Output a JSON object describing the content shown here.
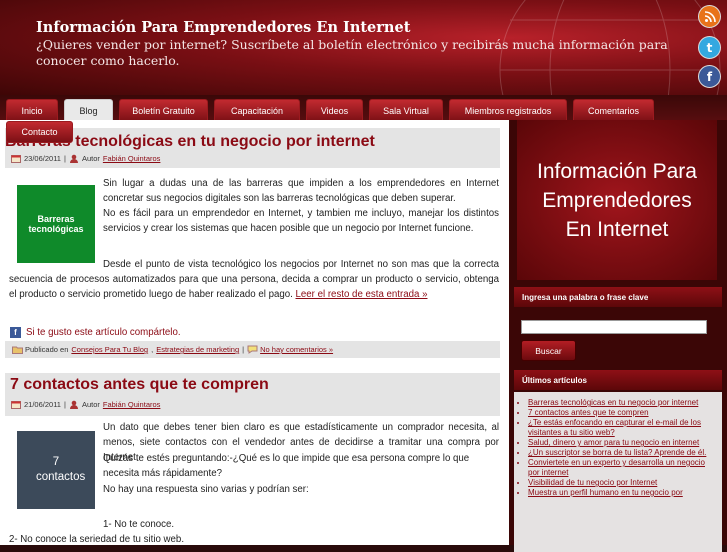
{
  "header": {
    "site_title": "Información Para Emprendedores En Internet",
    "tagline": "¿Quieres vender por internet? Suscríbete al boletín electrónico y recibirás mucha información para conocer como hacerlo."
  },
  "social": {
    "rss": "rss-icon",
    "twitter": "twitter-icon",
    "facebook": "facebook-icon"
  },
  "nav": {
    "tabs": [
      {
        "label": "Inicio"
      },
      {
        "label": "Blog"
      },
      {
        "label": "Boletín Gratuito"
      },
      {
        "label": "Capacitación"
      },
      {
        "label": "Videos"
      },
      {
        "label": "Sala Virtual"
      },
      {
        "label": "Miembros registrados"
      },
      {
        "label": "Comentarios"
      },
      {
        "label": "Contacto"
      }
    ]
  },
  "posts": [
    {
      "title": "Barreras tecnológicas en tu negocio por internet",
      "date": "23/06/2011",
      "author_prefix": "Autor",
      "author": "Fabián Quintaros",
      "thumb_text": "Barreras tecnológicas",
      "p1": "Sin lugar a dudas una de las barreras que impiden a los emprendedores en Internet concretar sus negocios digitales son las barreras tecnológicas que deben superar.",
      "p2": "No es fácil para un emprendedor en Internet, y tambien me incluyo, manejar los distintos servicios y crear los sistemas que hacen posible que un negocio por Internet funcione.",
      "p3": "Desde el punto de vista tecnológico los negocios por Internet no son mas que la correcta secuencia de procesos automatizados para que una persona, decida a comprar un producto o servicio, obtenga el producto o servicio prometido luego de haber realizado el pago.",
      "read_more": "Leer el resto de esta entrada »",
      "share_text": "Si te gusto este artículo compártelo.",
      "published_in": "Publicado en",
      "cat1": "Consejos Para Tu Blog",
      "cat2": "Estrategias de marketing",
      "comments": "No hay comentarios »"
    },
    {
      "title": "7 contactos antes que te compren",
      "date": "21/06/2011",
      "author_prefix": "Autor",
      "author": "Fabián Quintaros",
      "thumb_text": "7 contactos",
      "p1": "Un dato que debes tener bien claro es que estadísticamente un comprador necesita, al menos, siete contactos con el vendedor antes de decidirse a tramitar una compra por Internet.",
      "p2": "Quizás te estés preguntando:-¿Qué es lo que impide que esa persona compre lo que necesita más rápidamente?",
      "p3": "No hay una respuesta sino varias y podrían ser:",
      "p4": "1- No te conoce.",
      "p5": "2- No conoce la seriedad de tu sitio web."
    }
  ],
  "sidebar": {
    "promo_text": "Información Para Emprendedores En Internet",
    "search_title": "Ingresa una palabra o frase clave",
    "search_placeholder": "",
    "search_button": "Buscar",
    "recent_title": "Últimos artículos",
    "recent": [
      "Barreras tecnológicas en tu negocio por internet",
      "7 contactos antes que te compren",
      "¿Te estás enfocando en capturar el e-mail de los visitantes a tu sitio web?",
      "Salud, dinero y amor para tu negocio en internet",
      "¿Un suscriptor se borra de tu lista? Aprende de él.",
      "Conviertete en un experto y desarrolla un negocio por internet",
      "Visibilidad de tu negocio por Internet",
      "Muestra un perfil humano en tu negocio por"
    ]
  },
  "colors": {
    "accent": "#8b0a14",
    "nav_bg": "#5a0e10",
    "sidebar_bg": "#3b0606"
  }
}
